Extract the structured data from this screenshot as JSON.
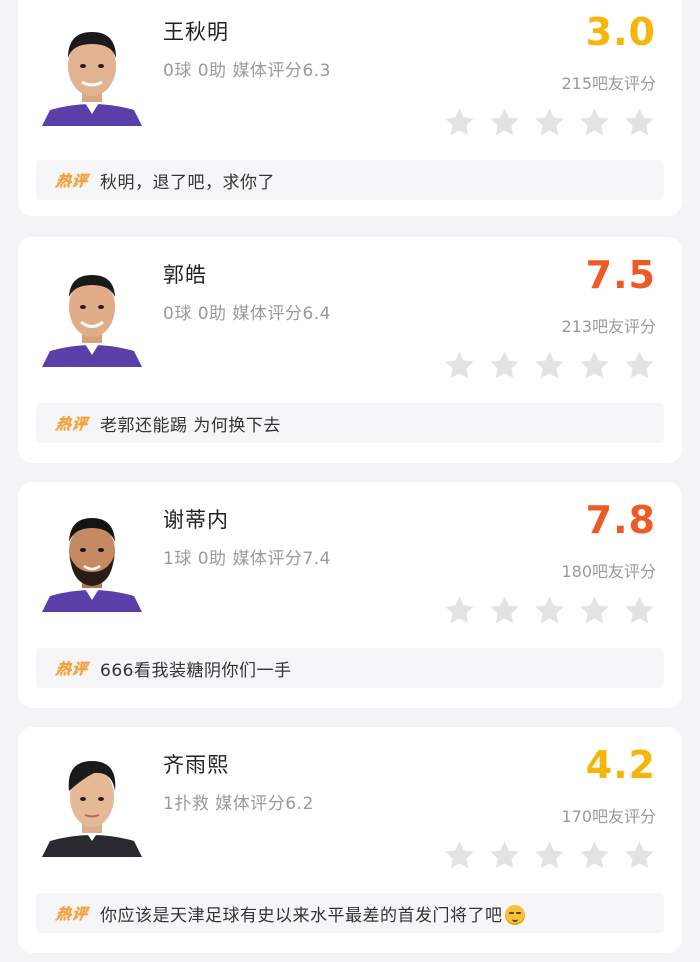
{
  "hot_label": "热评",
  "colors": {
    "score_low": "#f5b50a",
    "score_high": "#ee5a24",
    "star": "#e3e3e3"
  },
  "players": [
    {
      "name": "王秋明",
      "stats": "0球 0助  媒体评分6.3",
      "score": "3.0",
      "score_color": "#f5b50a",
      "count": "215吧友评分",
      "rating_stars": 0,
      "comment": "秋明，退了吧，求你了",
      "avatar": "player-photo",
      "kit_color": "#5b3fa8"
    },
    {
      "name": "郭皓",
      "stats": "0球 0助  媒体评分6.4",
      "score": "7.5",
      "score_color": "#ee5a24",
      "count": "213吧友评分",
      "rating_stars": 0,
      "comment": "老郭还能踢 为何换下去",
      "avatar": "player-photo",
      "kit_color": "#5b3fa8"
    },
    {
      "name": "谢蒂内",
      "stats": "1球 0助  媒体评分7.4",
      "score": "7.8",
      "score_color": "#ee5a24",
      "count": "180吧友评分",
      "rating_stars": 0,
      "comment": "666看我装糖阴你们一手",
      "avatar": "player-photo",
      "kit_color": "#5b3fa8"
    },
    {
      "name": "齐雨熙",
      "stats": "1扑救  媒体评分6.2",
      "score": "4.2",
      "score_color": "#f5b50a",
      "count": "170吧友评分",
      "rating_stars": 0,
      "comment": "你应该是天津足球有史以来水平最差的首发门将了吧",
      "avatar": "player-photo",
      "kit_color": "#2a2a2e"
    }
  ]
}
